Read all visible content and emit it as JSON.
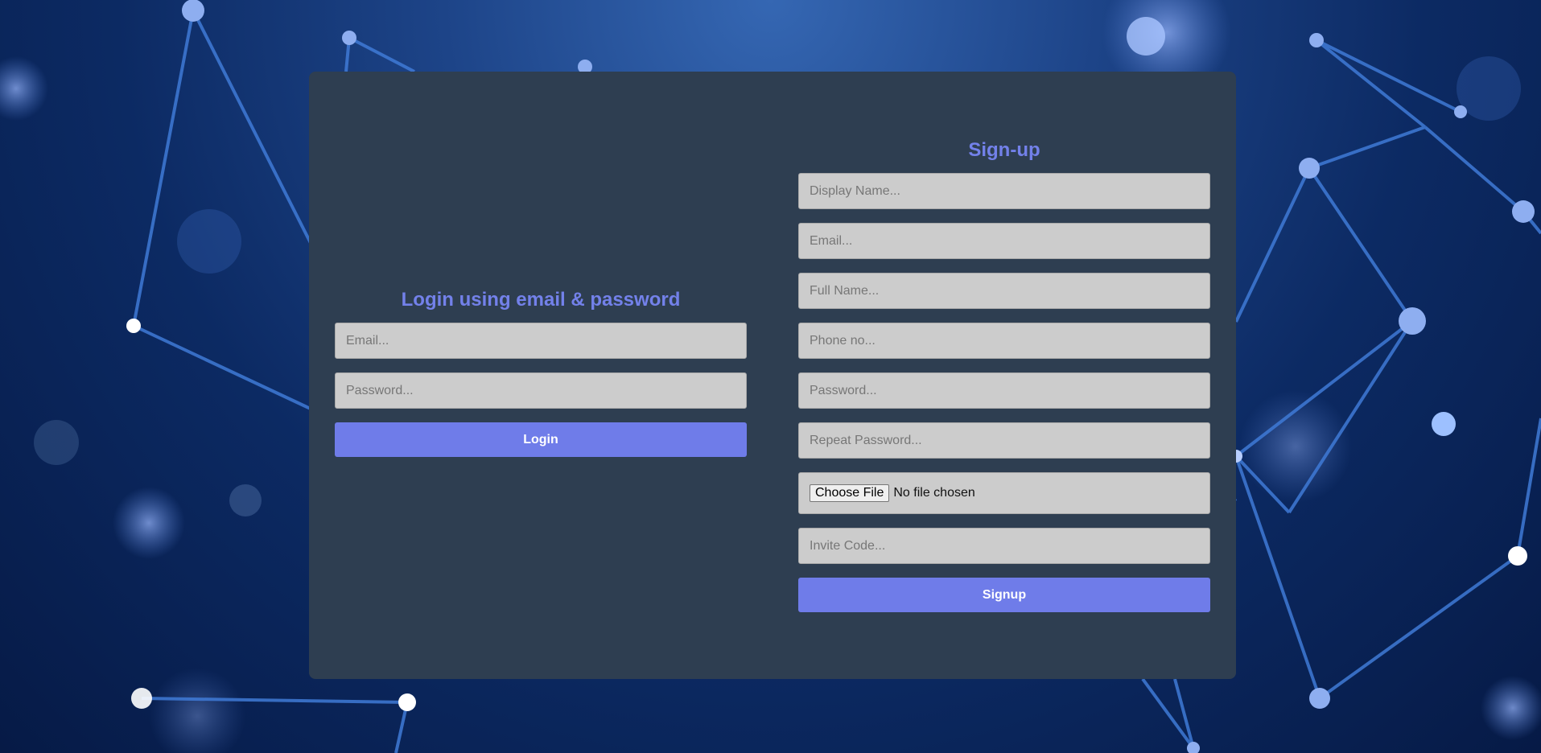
{
  "login": {
    "heading": "Login using email & password",
    "email_placeholder": "Email...",
    "password_placeholder": "Password...",
    "button_label": "Login"
  },
  "signup": {
    "heading": "Sign-up",
    "display_name_placeholder": "Display Name...",
    "email_placeholder": "Email...",
    "full_name_placeholder": "Full Name...",
    "phone_placeholder": "Phone no...",
    "password_placeholder": "Password...",
    "repeat_password_placeholder": "Repeat Password...",
    "file_button_label": "Choose File",
    "file_status": "No file chosen",
    "invite_code_placeholder": "Invite Code...",
    "button_label": "Signup"
  },
  "colors": {
    "accent": "#6f7ce9",
    "heading": "#7381ea",
    "panel": "#2e3e51",
    "field": "#cccccc"
  }
}
